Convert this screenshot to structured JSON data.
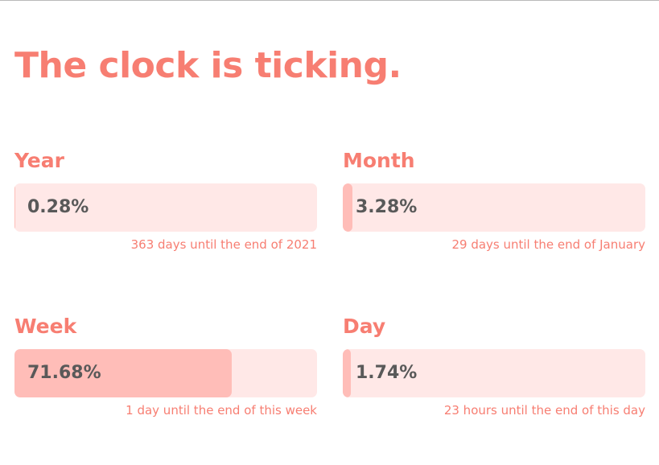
{
  "title": "The clock is ticking.",
  "colors": {
    "accent": "#f77e72",
    "track": "#ffe8e7",
    "fill": "#ffbdb8",
    "percent_text": "#595959"
  },
  "cards": {
    "year": {
      "label": "Year",
      "percent_text": "0.28%",
      "progress": 0.0028,
      "caption": "363 days until the end of 2021"
    },
    "month": {
      "label": "Month",
      "percent_text": "3.28%",
      "progress": 0.0328,
      "caption": "29 days until the end of January"
    },
    "week": {
      "label": "Week",
      "percent_text": "71.68%",
      "progress": 0.7168,
      "caption": "1 day until the end of this week"
    },
    "day": {
      "label": "Day",
      "percent_text": "1.74%",
      "progress": 0.0174,
      "caption": "23 hours until the end of this day"
    }
  }
}
